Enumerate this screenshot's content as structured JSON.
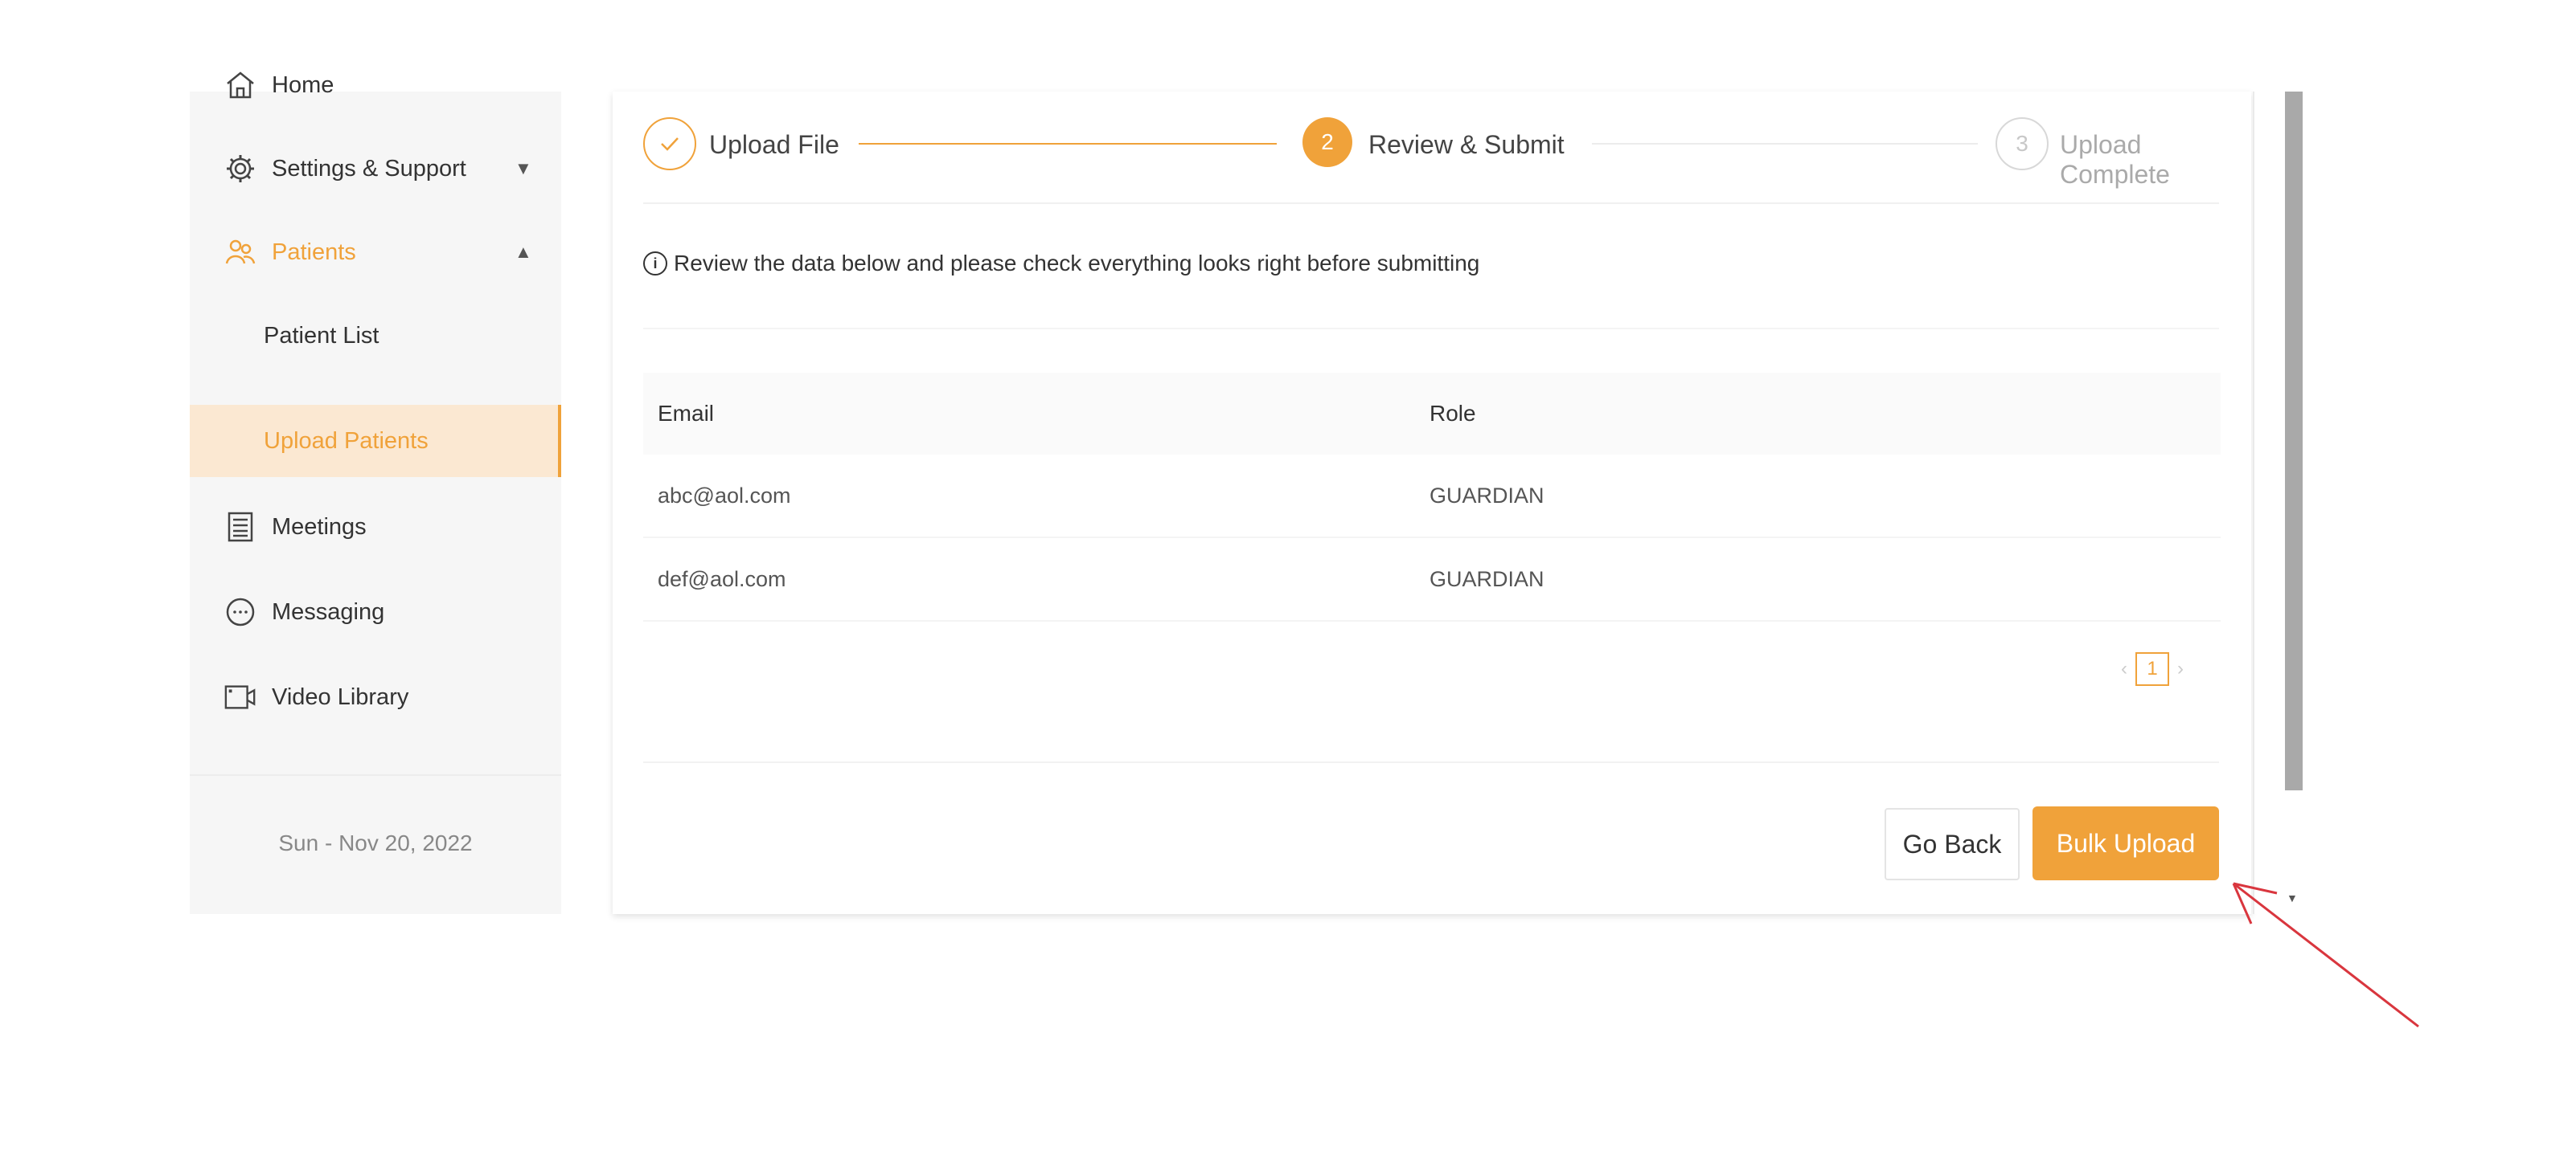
{
  "sidebar": {
    "items": [
      {
        "label": "Home",
        "icon": "home-icon"
      },
      {
        "label": "Settings & Support",
        "icon": "gear-icon",
        "chevron": "down"
      },
      {
        "label": "Patients",
        "icon": "patients-icon",
        "chevron": "up",
        "active": true
      },
      {
        "label": "Patient List"
      },
      {
        "label": "Upload Patients",
        "selected": true
      },
      {
        "label": "Meetings",
        "icon": "meetings-icon"
      },
      {
        "label": "Messaging",
        "icon": "chat-icon"
      },
      {
        "label": "Video Library",
        "icon": "video-icon"
      }
    ],
    "date": "Sun - Nov 20, 2022"
  },
  "steps": [
    {
      "label": "Upload File",
      "number": "",
      "status": "done"
    },
    {
      "label": "Review & Submit",
      "number": "2",
      "status": "active"
    },
    {
      "label": "Upload Complete",
      "number": "3",
      "status": "wait"
    }
  ],
  "info_text": "Review the data below and please check everything looks right before submitting",
  "table": {
    "headers": [
      "Email",
      "Role"
    ],
    "rows": [
      [
        "abc@aol.com",
        "GUARDIAN"
      ],
      [
        "def@aol.com",
        "GUARDIAN"
      ]
    ]
  },
  "pagination": {
    "prev": "‹",
    "current": "1",
    "next": "›"
  },
  "buttons": {
    "back": "Go Back",
    "upload": "Bulk Upload"
  },
  "colors": {
    "accent": "#f0a23a",
    "accent_light": "#fbe8d2",
    "annotation_arrow": "#d9363e"
  }
}
